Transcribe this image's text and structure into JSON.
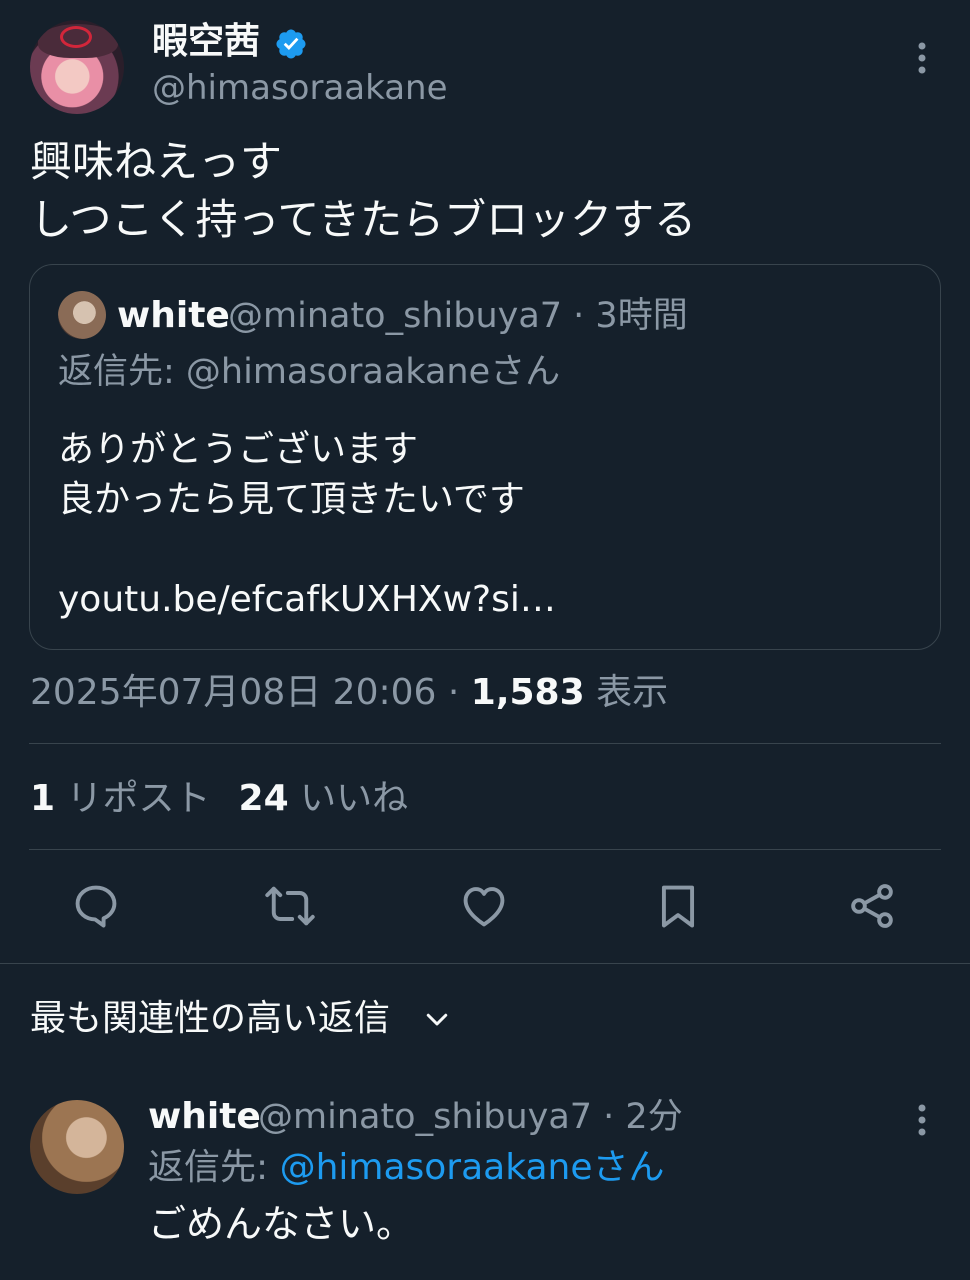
{
  "tweet": {
    "display_name": "暇空茜",
    "handle": "@himasoraakane",
    "text": "興味ねえっす\nしつこく持ってきたらブロックする",
    "verified_icon": "verified-badge-icon",
    "colors": {
      "accent": "#1d9bf0",
      "background": "#15202b",
      "muted": "#8b98a5"
    }
  },
  "quote": {
    "name": "white",
    "meta": "@minato_shibuya7 · 3時間",
    "reply_to": "返信先: @himasoraakaneさん",
    "text": "ありがとうございます\n良かったら見て頂きたいです\n\nyoutu.be/efcafkUXHXw?si…"
  },
  "meta": {
    "timestamp": "2025年07月08日 20:06 · ",
    "views_count": "1,583",
    "views_label": " 表示"
  },
  "stats": {
    "reposts_count": "1",
    "reposts_label": " リポスト",
    "likes_count": "24",
    "likes_label": " いいね"
  },
  "actions": [
    "reply-icon",
    "retweet-icon",
    "like-icon",
    "bookmark-icon",
    "share-icon"
  ],
  "replies": {
    "header": "最も関連性の高い返信",
    "items": [
      {
        "name": "white",
        "meta": "@minato_shibuya7 · 2分",
        "reply_prefix": "返信先: ",
        "reply_mention": "@himasoraakaneさん",
        "text": "ごめんなさい。"
      }
    ]
  }
}
